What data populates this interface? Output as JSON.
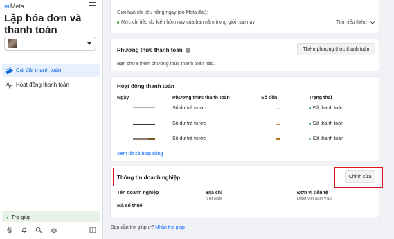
{
  "brand": {
    "logo_text": "Meta"
  },
  "sidebar": {
    "title": "Lập hóa đơn và thanh toán",
    "nav": [
      {
        "label": "Cài đặt thanh toán",
        "active": true
      },
      {
        "label": "Hoạt động thanh toán",
        "active": false
      }
    ],
    "help_label": "Trợ giúp"
  },
  "spending_limit": {
    "title": "Giới hạn chi tiêu hằng ngày (do Meta đặt):",
    "status": "Mức chi tiêu dự kiến hôm nay của bạn nằm trong giới hạn này",
    "learn_more": "Tìm hiểu thêm"
  },
  "payment_methods": {
    "title": "Phương thức thanh toán",
    "add_button": "Thêm phương thức thanh toán",
    "empty_text": "Bạn chưa thêm phương thức thanh toán nào."
  },
  "payment_activity": {
    "title": "Hoạt động thanh toán",
    "columns": [
      "Ngày",
      "Phương thức thanh toán",
      "Số tiền",
      "Trạng thái"
    ],
    "rows": [
      {
        "method": "Số dư trả trước",
        "status": "Đã thanh toán"
      },
      {
        "method": "Số dư trả trước",
        "status": "Đã thanh toán"
      },
      {
        "method": "Số dư trả trước",
        "status": "Đã thanh toán"
      }
    ],
    "view_all": "Xem tất cả hoạt động"
  },
  "business_info": {
    "title": "Thông tin doanh nghiệp",
    "edit_button": "Chỉnh sửa",
    "fields": {
      "name_label": "Tên doanh nghiệp",
      "address_label": "Địa chỉ",
      "address_value": "Việt Nam",
      "currency_label": "Đơn vị tiền tệ",
      "currency_value": "Đồng Việt Nam VND",
      "tax_label": "Mã số thuế"
    }
  },
  "footer": {
    "question": "Bạn cần trợ giúp ư?",
    "link": "Nhận trợ giúp"
  },
  "colors": {
    "accent": "#0866ff",
    "highlight": "#e0141e",
    "success": "#31a24c"
  }
}
